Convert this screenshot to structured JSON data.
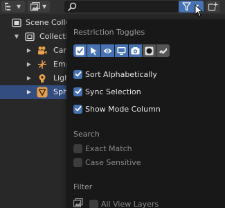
{
  "header": {
    "editor_type_icon": "outliner-icon",
    "display_mode_icon": "view-layer-icon",
    "search_value": "",
    "filter_icon": "funnel-icon",
    "new_collection_icon": "new-collection-icon"
  },
  "tree": {
    "rows": [
      {
        "label": "Scene Collection",
        "icon": "scene-collection-icon"
      },
      {
        "label": "Collection",
        "icon": "collection-icon"
      },
      {
        "label": "Camera",
        "icon": "camera-object-icon"
      },
      {
        "label": "Empty",
        "icon": "empty-object-icon"
      },
      {
        "label": "Light",
        "icon": "light-object-icon"
      },
      {
        "label": "Sphere",
        "icon": "mesh-object-icon",
        "selected": true
      }
    ]
  },
  "popover": {
    "restriction_title": "Restriction Toggles",
    "toggles": [
      {
        "icon": "checkbox-icon",
        "active": true
      },
      {
        "icon": "select-cursor-icon",
        "active": true
      },
      {
        "icon": "eye-icon",
        "active": true
      },
      {
        "icon": "monitor-icon",
        "active": true
      },
      {
        "icon": "camera-icon",
        "active": true
      },
      {
        "icon": "holdout-icon",
        "active": false
      },
      {
        "icon": "indirect-only-icon",
        "active": false
      }
    ],
    "options": {
      "sort_alphabetically": {
        "label": "Sort Alphabetically",
        "checked": true
      },
      "sync_selection": {
        "label": "Sync Selection",
        "checked": true
      },
      "show_mode_column": {
        "label": "Show Mode Column",
        "checked": true
      }
    },
    "search_title": "Search",
    "search_options": {
      "exact_match": {
        "label": "Exact Match",
        "checked": false
      },
      "case_sensitive": {
        "label": "Case Sensitive",
        "checked": false
      }
    },
    "filter_title": "Filter",
    "filter_options": {
      "all_view_layers": {
        "label": "All View Layers",
        "checked": false
      }
    }
  },
  "colors": {
    "accent": "#4772b3",
    "selection": "#334d80",
    "panel": "#181818",
    "editor_bg": "#282828"
  }
}
